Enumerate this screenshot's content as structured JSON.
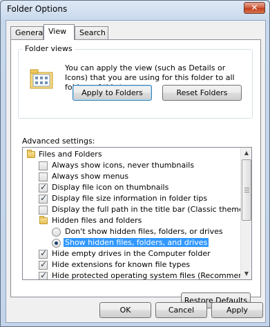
{
  "window": {
    "title": "Folder Options",
    "close_glyph": "✕"
  },
  "tabs": [
    {
      "label": "General",
      "active": false
    },
    {
      "label": "View",
      "active": true
    },
    {
      "label": "Search",
      "active": false
    }
  ],
  "folder_views": {
    "legend": "Folder views",
    "description": "You can apply the view (such as Details or Icons) that you are using for this folder to all folders of this type.",
    "apply_label": "Apply to Folders",
    "reset_label": "Reset Folders",
    "icon": "folder-view-icon"
  },
  "advanced": {
    "label": "Advanced settings:",
    "items": [
      {
        "kind": "folder",
        "label": "Files and Folders",
        "indent": 0
      },
      {
        "kind": "checkbox",
        "label": "Always show icons, never thumbnails",
        "checked": false,
        "indent": 1
      },
      {
        "kind": "checkbox",
        "label": "Always show menus",
        "checked": false,
        "indent": 1
      },
      {
        "kind": "checkbox",
        "label": "Display file icon on thumbnails",
        "checked": true,
        "indent": 1
      },
      {
        "kind": "checkbox",
        "label": "Display file size information in folder tips",
        "checked": true,
        "indent": 1
      },
      {
        "kind": "checkbox",
        "label": "Display the full path in the title bar (Classic theme only)",
        "checked": false,
        "indent": 1
      },
      {
        "kind": "folder",
        "label": "Hidden files and folders",
        "indent": 1
      },
      {
        "kind": "radio",
        "label": "Don't show hidden files, folders, or drives",
        "checked": false,
        "indent": 2
      },
      {
        "kind": "radio",
        "label": "Show hidden files, folders, and drives",
        "checked": true,
        "selected": true,
        "indent": 2
      },
      {
        "kind": "checkbox",
        "label": "Hide empty drives in the Computer folder",
        "checked": true,
        "indent": 1
      },
      {
        "kind": "checkbox",
        "label": "Hide extensions for known file types",
        "checked": true,
        "indent": 1
      },
      {
        "kind": "checkbox",
        "label": "Hide protected operating system files (Recommended)",
        "checked": true,
        "indent": 1
      }
    ]
  },
  "restore_label": "Restore Defaults",
  "footer": {
    "ok": "OK",
    "cancel": "Cancel",
    "apply": "Apply"
  },
  "colors": {
    "selection": "#3399ff",
    "title_bar": "#c7d8ec",
    "close_button": "#c13a1b"
  }
}
